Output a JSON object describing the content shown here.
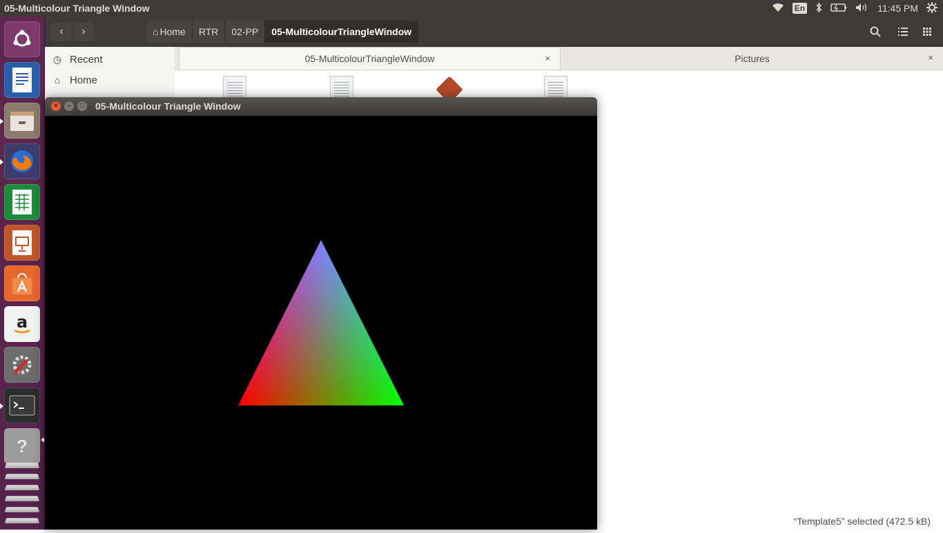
{
  "top_panel": {
    "title": "05-Multicolour Triangle Window",
    "keyboard_layout": "En",
    "clock": "11:45 PM"
  },
  "launcher": {
    "items": [
      {
        "name": "ubuntu-dash",
        "color": "#7b3a6b"
      },
      {
        "name": "libreoffice-writer",
        "color": "#2a5ea8"
      },
      {
        "name": "files",
        "color": "#8a7b6a"
      },
      {
        "name": "firefox",
        "color": "#e66000"
      },
      {
        "name": "libreoffice-calc",
        "color": "#1d8a3c"
      },
      {
        "name": "libreoffice-impress",
        "color": "#c0562a"
      },
      {
        "name": "ubuntu-software",
        "color": "#e7672d"
      },
      {
        "name": "amazon",
        "color": "#f2f2f2"
      },
      {
        "name": "system-settings",
        "color": "#6c6c6c"
      },
      {
        "name": "terminal",
        "color": "#2c2c2c"
      },
      {
        "name": "help",
        "color": "#9b9b9b"
      }
    ]
  },
  "file_manager": {
    "breadcrumb": [
      "Home",
      "RTR",
      "02-PP",
      "05-MulticolourTriangleWindow"
    ],
    "sidebar": [
      {
        "label": "Recent",
        "icon": "clock-icon"
      },
      {
        "label": "Home",
        "icon": "home-icon"
      }
    ],
    "tabs": [
      {
        "label": "05-MulticolourTriangleWindow",
        "close": "×"
      },
      {
        "label": "Pictures",
        "close": "×"
      }
    ],
    "status": "“Template5” selected  (472.5 kB)"
  },
  "gl_window": {
    "title": "05-Multicolour Triangle Window",
    "triangle": {
      "top_color": "#0000ff",
      "left_color": "#ff0000",
      "right_color": "#00ff00"
    }
  }
}
